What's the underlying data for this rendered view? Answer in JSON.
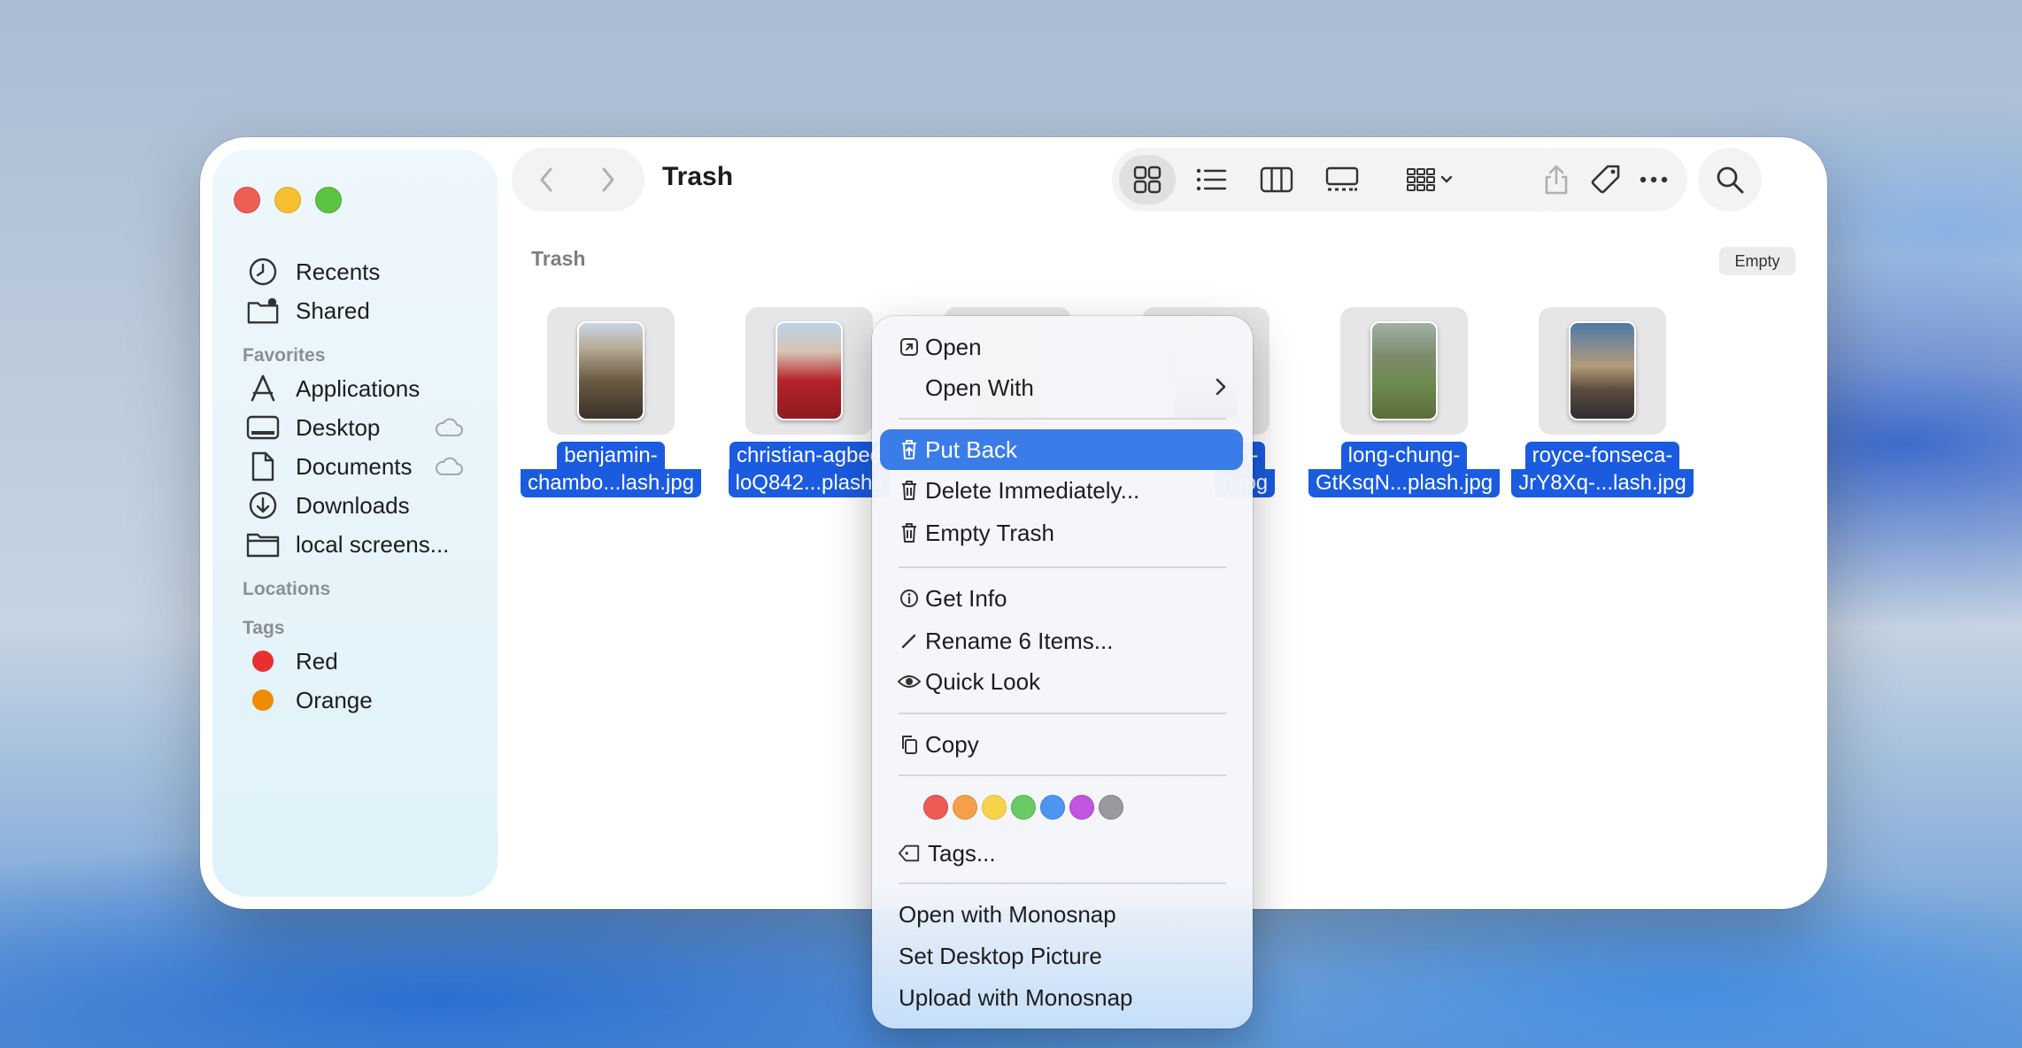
{
  "window": {
    "title": "Trash",
    "path_label": "Trash",
    "empty_button": "Empty"
  },
  "sidebar": {
    "items_top": [
      {
        "label": "Recents",
        "icon": "clock-icon"
      },
      {
        "label": "Shared",
        "icon": "shared-folder-icon"
      }
    ],
    "favorites_header": "Favorites",
    "favorites": [
      {
        "label": "Applications",
        "icon": "applications-icon"
      },
      {
        "label": "Desktop",
        "icon": "desktop-icon",
        "cloud": true
      },
      {
        "label": "Documents",
        "icon": "document-icon",
        "cloud": true
      },
      {
        "label": "Downloads",
        "icon": "download-icon"
      },
      {
        "label": "local screens...",
        "icon": "folder-icon"
      }
    ],
    "locations_header": "Locations",
    "tags_header": "Tags",
    "tags": [
      {
        "label": "Red",
        "color": "#e8312f"
      },
      {
        "label": "Orange",
        "color": "#f08a00"
      }
    ]
  },
  "files": [
    {
      "line1": "benjamin-",
      "line2": "chambo...lash.jpg"
    },
    {
      "line1": "christian-agbed",
      "line2": "loQ842...plash.j"
    },
    {
      "line1": "",
      "line2": ""
    },
    {
      "line1": "-kb-",
      "line2": "n.jpg"
    },
    {
      "line1": "long-chung-",
      "line2": "GtKsqN...plash.jpg"
    },
    {
      "line1": "royce-fonseca-",
      "line2": "JrY8Xq-...lash.jpg"
    }
  ],
  "context_menu": {
    "open": "Open",
    "open_with": "Open With",
    "put_back": "Put Back",
    "delete_immediately": "Delete Immediately...",
    "empty_trash": "Empty Trash",
    "get_info": "Get Info",
    "rename": "Rename 6 Items...",
    "quick_look": "Quick Look",
    "copy": "Copy",
    "tag_colors": [
      "#ef5a57",
      "#f4a04a",
      "#f6d34a",
      "#6acb66",
      "#4c96f2",
      "#c156e0",
      "#9a9a9e"
    ],
    "tags": "Tags...",
    "open_monosnap": "Open with Monosnap",
    "set_desktop": "Set Desktop Picture",
    "upload_monosnap": "Upload with Monosnap"
  }
}
